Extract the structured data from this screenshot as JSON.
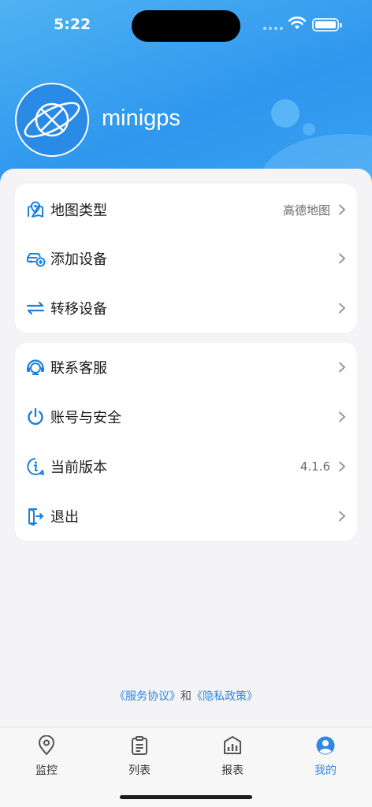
{
  "status_bar": {
    "time": "5:22"
  },
  "profile": {
    "app_name": "minigps"
  },
  "menu_group_1": [
    {
      "label": "地图类型",
      "value": "高德地图",
      "icon": "map-pin-icon"
    },
    {
      "label": "添加设备",
      "value": "",
      "icon": "car-add-icon"
    },
    {
      "label": "转移设备",
      "value": "",
      "icon": "transfer-arrows-icon"
    }
  ],
  "menu_group_2": [
    {
      "label": "联系客服",
      "value": "",
      "icon": "headset-icon"
    },
    {
      "label": "账号与安全",
      "value": "",
      "icon": "power-icon"
    },
    {
      "label": "当前版本",
      "value": "4.1.6",
      "icon": "info-icon"
    },
    {
      "label": "退出",
      "value": "",
      "icon": "exit-icon"
    }
  ],
  "agreement": {
    "service_link": "《服务协议》",
    "and_text": "和",
    "privacy_link": "《隐私政策》"
  },
  "tabs": [
    {
      "label": "监控",
      "icon": "location-pin-icon"
    },
    {
      "label": "列表",
      "icon": "clipboard-list-icon"
    },
    {
      "label": "报表",
      "icon": "bar-chart-icon"
    },
    {
      "label": "我的",
      "icon": "user-circle-icon"
    }
  ],
  "colors": {
    "accent": "#2f88e3",
    "header": "#3aa3f0",
    "icon_blue": "#1e7fe0"
  }
}
